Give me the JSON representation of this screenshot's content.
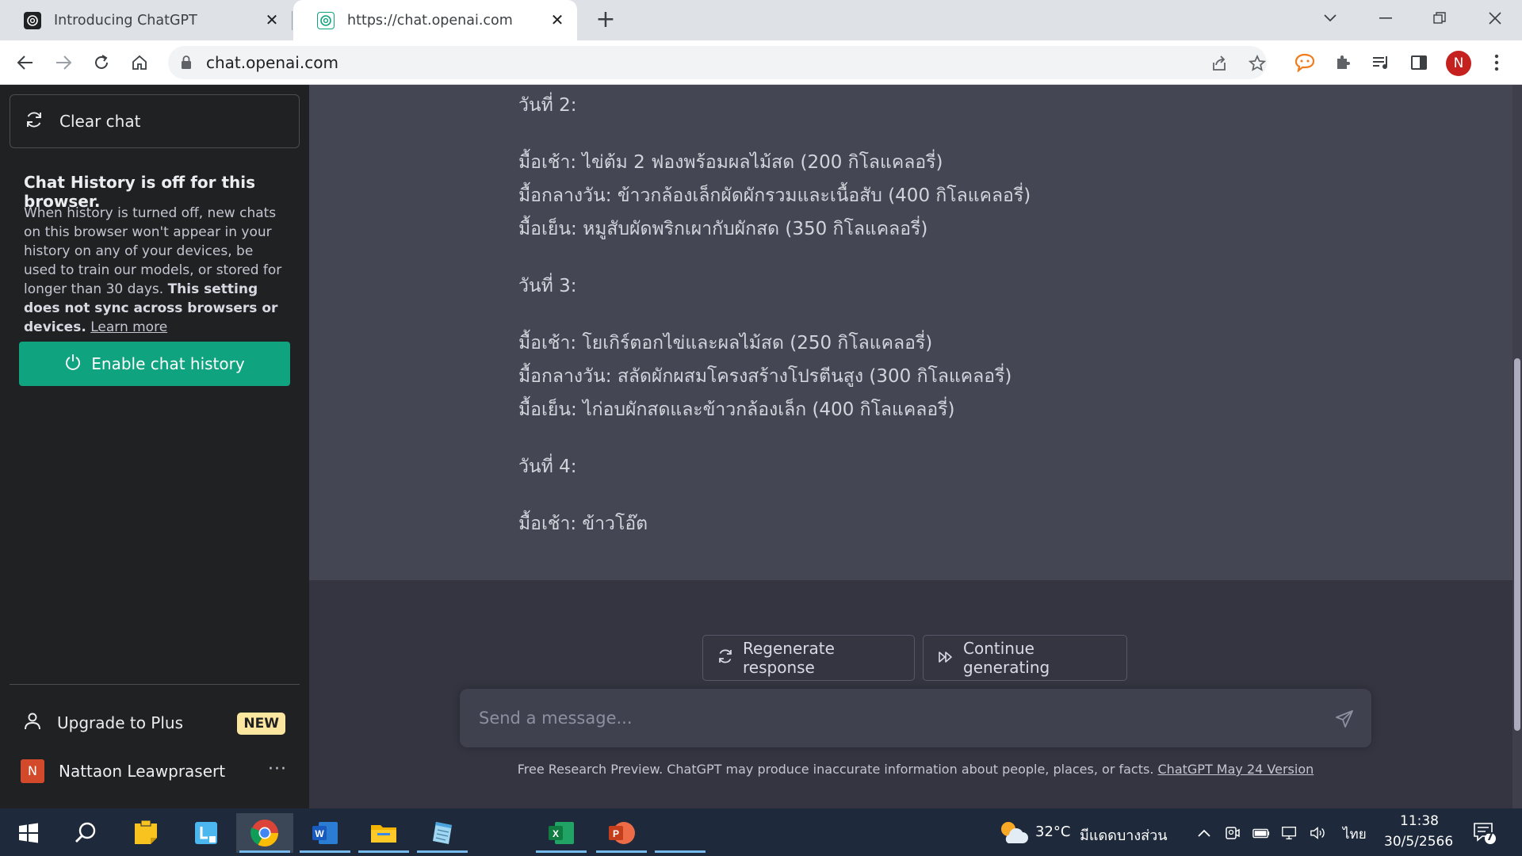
{
  "browser": {
    "tabs": [
      {
        "title": "Introducing ChatGPT",
        "close": "✕"
      },
      {
        "title": "https://chat.openai.com",
        "close": "✕"
      }
    ],
    "new_tab": "+",
    "url": "chat.openai.com",
    "profile_initial": "N"
  },
  "sidebar": {
    "clear_chat": "Clear chat",
    "history_title": "Chat History is off for this browser.",
    "history_note": "When history is turned off, new chats on this browser won't appear in your history on any of your devices, be used to train our models, or stored for longer than 30 days.",
    "history_note_bold": "This setting does not sync across browsers or devices.",
    "learn_more": "Learn more",
    "enable_history": "Enable chat history",
    "upgrade": "Upgrade to Plus",
    "new_badge": "NEW",
    "user_initial": "N",
    "user_name": "Nattaon Leawprasert",
    "user_menu": "···"
  },
  "chat": {
    "lines": [
      "วันที่ 2:",
      "มื้อเช้า: ไข่ต้ม 2 ฟองพร้อมผลไม้สด (200 กิโลแคลอรี่)",
      "มื้อกลางวัน: ข้าวกล้องเล็กผัดผักรวมและเนื้อสับ (400 กิโลแคลอรี่)",
      "มื้อเย็น: หมูสับผัดพริกเผากับผักสด (350 กิโลแคลอรี่)",
      "วันที่ 3:",
      "มื้อเช้า: โยเกิร์ตอกไข่และผลไม้สด (250 กิโลแคลอรี่)",
      "มื้อกลางวัน: สลัดผักผสมโครงสร้างโปรตีนสูง (300 กิโลแคลอรี่)",
      "มื้อเย็น: ไก่อบผักสดและข้าวกล้องเล็ก (400 กิโลแคลอรี่)",
      "วันที่ 4:",
      "มื้อเช้า: ข้าวโอ๊ต"
    ],
    "regenerate": "Regenerate response",
    "continue": "Continue generating",
    "input_placeholder": "Send a message...",
    "footer": "Free Research Preview. ChatGPT may produce inaccurate information about people, places, or facts.",
    "footer_link": "ChatGPT May 24 Version"
  },
  "taskbar": {
    "weather_temp": "32°C",
    "weather_desc": "มีแดดบางส่วน",
    "language": "ไทย",
    "time": "11:38",
    "date": "30/5/2566",
    "notification_count": "7"
  },
  "colors": {
    "accent_green": "#10a37f",
    "sidebar_bg": "#202123",
    "message_bg": "#444654",
    "main_bg": "#343541",
    "badge_yellow": "#fae69e"
  }
}
